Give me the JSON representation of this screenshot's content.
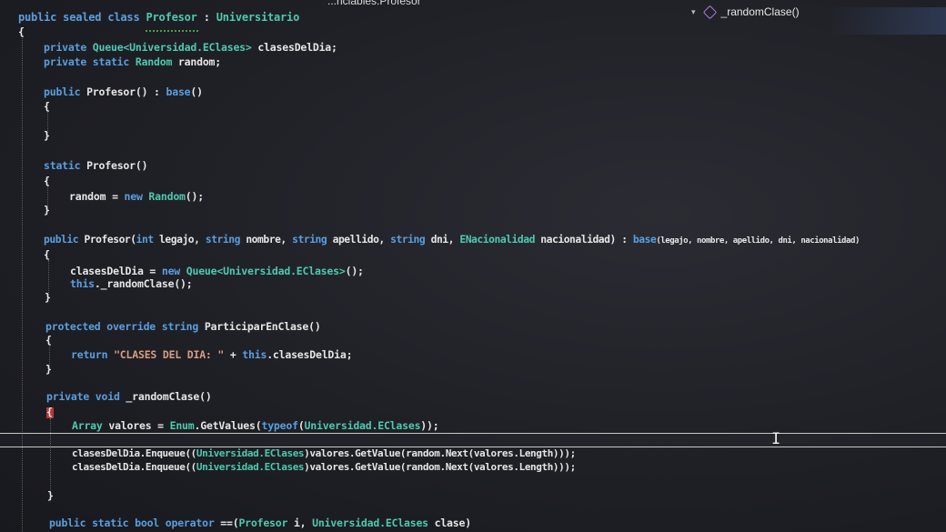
{
  "nav": {
    "left_path": "...nciables.Profesor",
    "right_member": "_randomClase()"
  },
  "code": {
    "l1": [
      "public sealed class ",
      "Profesor",
      " : ",
      "Universitario"
    ],
    "l2": "{",
    "l3": [
      "private ",
      "Queue<Universidad.EClases>",
      " clasesDelDia;"
    ],
    "l4": [
      "private static ",
      "Random",
      " random;"
    ],
    "l5": [
      "public ",
      "Profesor() : ",
      "base",
      "()"
    ],
    "l6": "{",
    "l7": "}",
    "l8": [
      "static ",
      "Profesor()"
    ],
    "l9": "{",
    "l10": [
      "random = ",
      "new ",
      "Random",
      "();"
    ],
    "l11": "}",
    "l12": [
      "public ",
      "Profesor(",
      "int ",
      "legajo, ",
      "string ",
      "nombre, ",
      "string ",
      "apellido, ",
      "string ",
      "dni, ",
      "ENacionalidad",
      " nacionalidad) : ",
      "base",
      "(legajo, nombre, apellido, dni, nacionalidad)"
    ],
    "l13": "{",
    "l14": [
      "clasesDelDia = ",
      "new ",
      "Queue<Universidad.EClases>",
      "();"
    ],
    "l15": [
      "this",
      "._randomClase();"
    ],
    "l16": "}",
    "l17": [
      "protected override string ",
      "ParticiparEnClase()"
    ],
    "l18": "{",
    "l19": [
      "return ",
      "\"CLASES DEL DIA: \"",
      " + ",
      "this",
      ".clasesDelDia;"
    ],
    "l20": "}",
    "l21": [
      "private void ",
      "_randomClase()"
    ],
    "l22": "{",
    "l23": [
      "Array",
      " valores = ",
      "Enum",
      ".GetValues(",
      "typeof",
      "(",
      "Universidad.EClases",
      "));"
    ],
    "l24": [
      "clasesDelDia.Enqueue((",
      "Universidad.EClases",
      ")valores.GetValue(random.Next(valores.Length)));"
    ],
    "l25": [
      "clasesDelDia.Enqueue((",
      "Universidad.EClases",
      ")valores.GetValue(random.Next(valores.Length)));"
    ],
    "l26": "}",
    "l27": [
      "public static bool operator ",
      "==(",
      "Profesor",
      " i, ",
      "Universidad.EClases",
      " clase)"
    ]
  },
  "colors": {
    "keyword": "#5a9fe0",
    "type": "#4ec9b0",
    "string": "#d69d85",
    "background": "#1f2026"
  }
}
